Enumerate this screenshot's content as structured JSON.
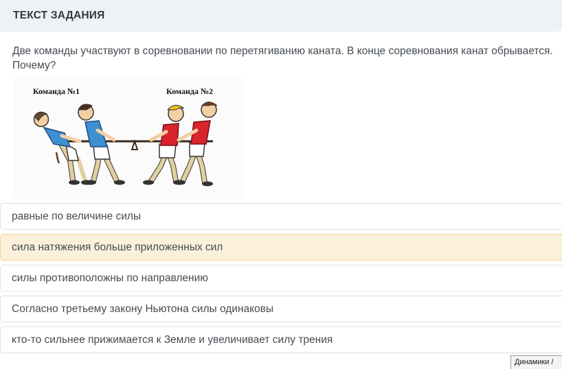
{
  "header": {
    "title": "ТЕКСТ ЗАДАНИЯ"
  },
  "question": {
    "text": "Две команды участвуют в соревновании по перетягиванию каната. В конце соревнования канат обрывается. Почему?"
  },
  "picture": {
    "team1_label": "Команда №1",
    "team2_label": "Команда №2"
  },
  "answers": [
    {
      "label": "равные по величине силы",
      "selected": false
    },
    {
      "label": "сила натяжения больше приложенных сил",
      "selected": true
    },
    {
      "label": "силы противоположны по направлению",
      "selected": false
    },
    {
      "label": "Согласно третьему закону Ньютона силы одинаковы",
      "selected": false
    },
    {
      "label": "кто-то сильнее прижимается к Земле и увеличивает силу трения",
      "selected": false
    }
  ],
  "taskbar": {
    "button_label": "Динамики /"
  },
  "colors": {
    "header_bg": "#eef1f5",
    "selected_bg": "#fbf0d9",
    "selected_border": "#f0d59c",
    "team1_shirt": "#3d8fd1",
    "team2_shirt": "#d9232d"
  }
}
